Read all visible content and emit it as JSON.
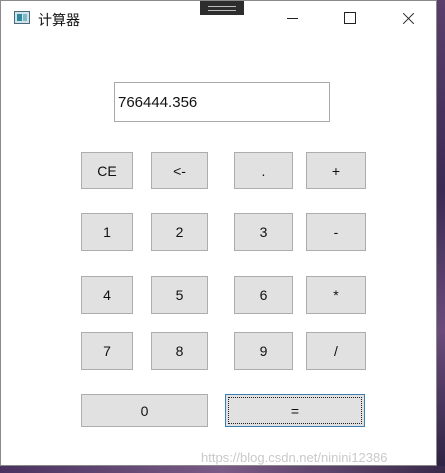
{
  "window": {
    "title": "计算器",
    "app_icon": "calculator-app-icon"
  },
  "display": {
    "value": "766444.356"
  },
  "keys": {
    "ce": "CE",
    "backspace": "<-",
    "dot": ".",
    "plus": "+",
    "one": "1",
    "two": "2",
    "three": "3",
    "minus": "-",
    "four": "4",
    "five": "5",
    "six": "6",
    "multiply": "*",
    "seven": "7",
    "eight": "8",
    "nine": "9",
    "divide": "/",
    "zero": "0",
    "equals": "="
  },
  "watermark": "https://blog.csdn.net/ninini12386"
}
